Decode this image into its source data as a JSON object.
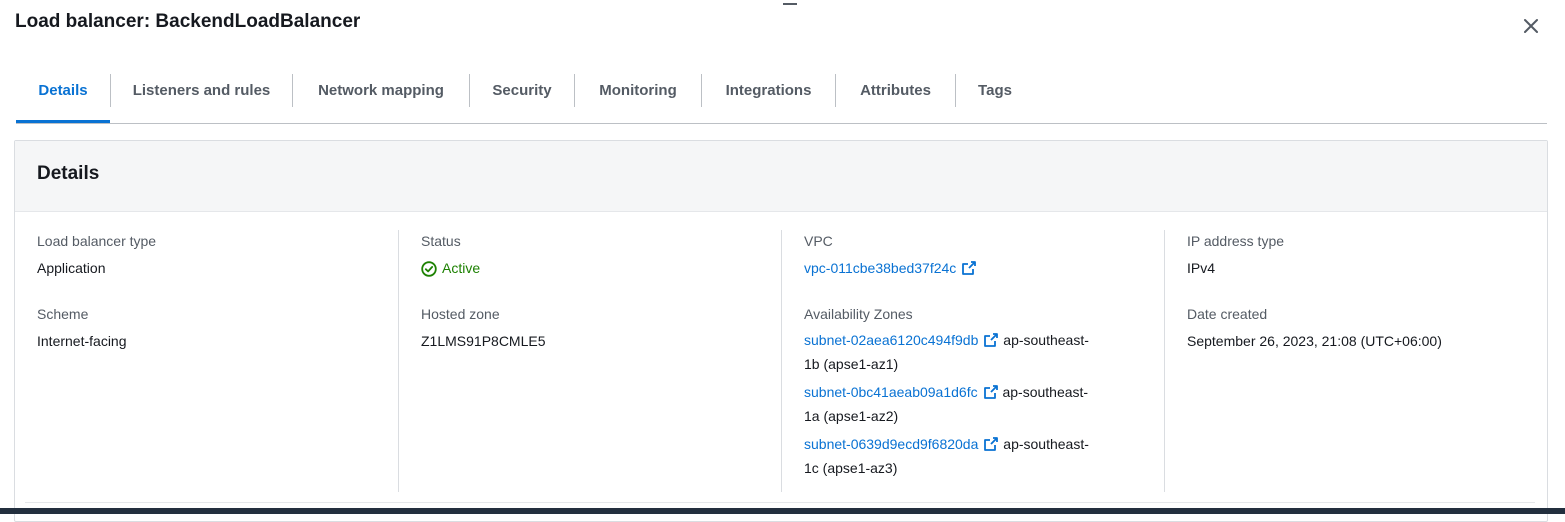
{
  "header": {
    "title": "Load balancer: BackendLoadBalancer"
  },
  "tabs": [
    {
      "label": "Details",
      "active": true
    },
    {
      "label": "Listeners and rules"
    },
    {
      "label": "Network mapping"
    },
    {
      "label": "Security"
    },
    {
      "label": "Monitoring"
    },
    {
      "label": "Integrations"
    },
    {
      "label": "Attributes"
    },
    {
      "label": "Tags"
    }
  ],
  "details": {
    "title": "Details",
    "lb_type": {
      "label": "Load balancer type",
      "value": "Application"
    },
    "scheme": {
      "label": "Scheme",
      "value": "Internet-facing"
    },
    "status": {
      "label": "Status",
      "value": "Active"
    },
    "hosted_zone": {
      "label": "Hosted zone",
      "value": "Z1LMS91P8CMLE5"
    },
    "vpc": {
      "label": "VPC",
      "value": "vpc-011cbe38bed37f24c"
    },
    "availability_zones": {
      "label": "Availability Zones",
      "items": [
        {
          "subnet": "subnet-02aea6120c494f9db",
          "zone_line1": "ap-southeast-",
          "zone_line2": "1b (apse1-az1)"
        },
        {
          "subnet": "subnet-0bc41aeab09a1d6fc",
          "zone_line1": "ap-southeast-",
          "zone_line2": "1a (apse1-az2)"
        },
        {
          "subnet": "subnet-0639d9ecd9f6820da",
          "zone_line1": "ap-southeast-",
          "zone_line2": "1c (apse1-az3)"
        }
      ]
    },
    "ip_type": {
      "label": "IP address type",
      "value": "IPv4"
    },
    "date_created": {
      "label": "Date created",
      "value": "September 26, 2023, 21:08 (UTC+06:00)"
    }
  },
  "icons": {
    "close": "close-icon",
    "status": "check-circle-icon",
    "external": "external-link-icon"
  },
  "colors": {
    "link": "#0972d3",
    "status_active": "#1d8102",
    "footer": "#232f3e"
  }
}
